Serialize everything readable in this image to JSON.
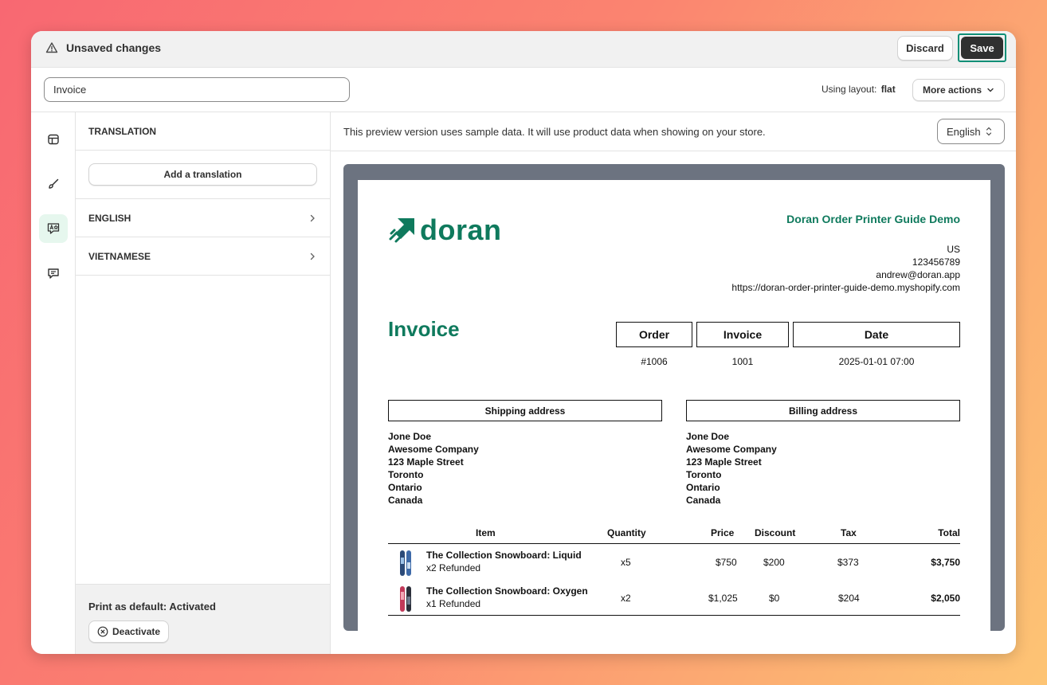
{
  "topbar": {
    "title": "Unsaved changes",
    "discard_label": "Discard",
    "save_label": "Save"
  },
  "toolbar": {
    "template_name": "Invoice",
    "layout_label": "Using layout:",
    "layout_value": "flat",
    "more_actions_label": "More actions"
  },
  "rail": {
    "items": [
      "layout-icon",
      "brush-icon",
      "translate-icon",
      "comment-icon"
    ],
    "active_index": 2
  },
  "translation_panel": {
    "heading": "TRANSLATION",
    "add_label": "Add a translation",
    "languages": [
      "ENGLISH",
      "VIETNAMESE"
    ],
    "footer_title": "Print as default: Activated",
    "deactivate_label": "Deactivate"
  },
  "preview": {
    "note": "This preview version uses sample data. It will use product data when showing on your store.",
    "language": "English"
  },
  "invoice": {
    "logo_text": "doran",
    "shop_name": "Doran Order Printer Guide Demo",
    "shop_lines": [
      "US",
      "123456789",
      "andrew@doran.app",
      "https://doran-order-printer-guide-demo.myshopify.com"
    ],
    "title": "Invoice",
    "meta_headers": [
      "Order",
      "Invoice",
      "Date"
    ],
    "meta_values": [
      "#1006",
      "1001",
      "2025-01-01 07:00"
    ],
    "shipping_label": "Shipping address",
    "billing_label": "Billing address",
    "shipping_lines": [
      "Jone Doe",
      "Awesome Company",
      "123 Maple Street",
      "Toronto",
      "Ontario",
      "Canada"
    ],
    "billing_lines": [
      "Jone Doe",
      "Awesome Company",
      "123 Maple Street",
      "Toronto",
      "Ontario",
      "Canada"
    ],
    "columns": [
      "Item",
      "Quantity",
      "Price",
      "Discount",
      "Tax",
      "Total"
    ],
    "items": [
      {
        "name": "The Collection Snowboard: Liquid",
        "sub": "x2 Refunded",
        "qty": "x5",
        "price": "$750",
        "discount": "$200",
        "tax": "$373",
        "total": "$3,750"
      },
      {
        "name": "The Collection Snowboard: Oxygen",
        "sub": "x1 Refunded",
        "qty": "x2",
        "price": "$1,025",
        "discount": "$0",
        "tax": "$204",
        "total": "$2,050"
      }
    ]
  },
  "colors": {
    "brand_green": "#0f7a5d",
    "save_bg": "#303030",
    "frame_gray": "#6c7380"
  }
}
